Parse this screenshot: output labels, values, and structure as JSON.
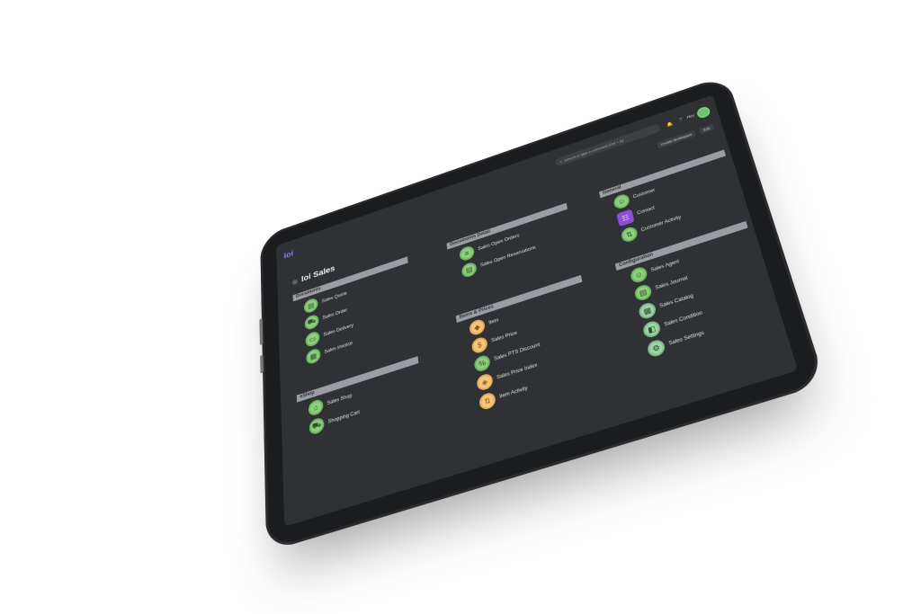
{
  "app": {
    "logo": "Ioi",
    "title": "Ioi Sales",
    "search_placeholder": "Search or type a command (Ctrl + G)",
    "user_name": "Hey",
    "create_workspace_label": "Create Workspace",
    "edit_label": "Edit"
  },
  "groups": [
    {
      "title": "Documents",
      "items": [
        {
          "label": "Sales Quote",
          "color": "green",
          "icon": "document-icon"
        },
        {
          "label": "Sales Order",
          "color": "green",
          "icon": "cart-icon"
        },
        {
          "label": "Sales Delivery",
          "color": "green",
          "icon": "truck-icon"
        },
        {
          "label": "Sales Invoice",
          "color": "green",
          "icon": "invoice-icon"
        }
      ]
    },
    {
      "title": "Documents Detail",
      "items": [
        {
          "label": "Sales Open Orders",
          "color": "green",
          "icon": "list-icon"
        },
        {
          "label": "Sales Open Reservations",
          "color": "green",
          "icon": "reservation-icon"
        }
      ]
    },
    {
      "title": "General",
      "items": [
        {
          "label": "Customer",
          "color": "green",
          "icon": "user-icon"
        },
        {
          "label": "Contact",
          "color": "purple",
          "icon": "contact-icon"
        },
        {
          "label": "Customer Activity",
          "color": "green",
          "icon": "activity-icon"
        }
      ]
    },
    {
      "title": "eShop",
      "items": [
        {
          "label": "Sales Shop",
          "color": "green",
          "icon": "shop-icon"
        },
        {
          "label": "Shopping Cart",
          "color": "green",
          "icon": "cart-icon"
        }
      ]
    },
    {
      "title": "Items & Prices",
      "items": [
        {
          "label": "Item",
          "color": "orange",
          "icon": "item-icon"
        },
        {
          "label": "Sales Price",
          "color": "orange",
          "icon": "price-icon"
        },
        {
          "label": "Sales PTS Discount",
          "color": "green",
          "icon": "discount-icon"
        },
        {
          "label": "Sales Price Index",
          "color": "orange",
          "icon": "index-icon"
        },
        {
          "label": "Item Activity",
          "color": "orange",
          "icon": "activity-icon"
        }
      ]
    },
    {
      "title": "Configuration",
      "items": [
        {
          "label": "Sales Agent",
          "color": "green",
          "icon": "agent-icon"
        },
        {
          "label": "Sales Journal",
          "color": "green",
          "icon": "journal-icon"
        },
        {
          "label": "Sales Catalog",
          "color": "teal",
          "icon": "catalog-icon"
        },
        {
          "label": "Sales Condition",
          "color": "teal",
          "icon": "condition-icon"
        },
        {
          "label": "Sales Settings",
          "color": "teal",
          "icon": "gear-icon"
        }
      ]
    }
  ]
}
